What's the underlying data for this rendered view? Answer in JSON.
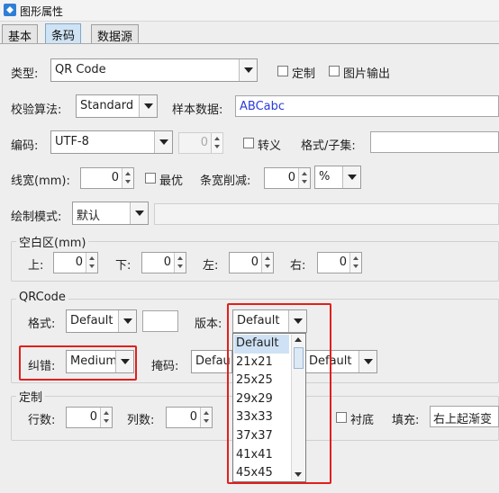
{
  "window": {
    "title": "图形属性"
  },
  "tabs": [
    "基本",
    "条码",
    "数据源"
  ],
  "colors": {
    "accent_tab": "#cfe3f5",
    "highlight_red": "#e0201c",
    "sample_text": "#2a3bd8"
  },
  "type_row": {
    "label": "类型:",
    "value": "QR Code",
    "custom_label": "定制",
    "image_output_label": "图片输出"
  },
  "checksum_row": {
    "label": "校验算法:",
    "value": "Standard",
    "sample_label": "样本数据:",
    "sample_value": "ABCabc"
  },
  "encoding_row": {
    "label": "编码:",
    "value": "UTF-8",
    "spin_value": "0",
    "escape_label": "转义",
    "format_label": "格式/子集:"
  },
  "linewidth_row": {
    "label": "线宽(mm):",
    "value": "0",
    "optimal_label": "最优",
    "bar_reduce_label": "条宽削减:",
    "bar_reduce_value": "0",
    "unit_value": "%"
  },
  "draw_mode_row": {
    "label": "绘制模式:",
    "value": "默认"
  },
  "quiet_zone": {
    "title": "空白区(mm)",
    "top_label": "上:",
    "top_value": "0",
    "bottom_label": "下:",
    "bottom_value": "0",
    "left_label": "左:",
    "left_value": "0",
    "right_label": "右:",
    "right_value": "0"
  },
  "qrcode": {
    "title": "QRCode",
    "format_label": "格式:",
    "format_value": "Default",
    "version_label": "版本:",
    "version_value": "Default",
    "ecc_label": "纠错:",
    "ecc_value": "Medium",
    "mask_label": "掩码:",
    "mask_value": "Default",
    "mode_value": "Default"
  },
  "custom_group": {
    "title": "定制",
    "rows_label": "行数:",
    "rows_value": "0",
    "cols_label": "列数:",
    "cols_value": "0",
    "bg_label": "衬底",
    "fill_label": "填充:",
    "fill_value": "右上起渐变"
  },
  "version_dropdown": {
    "items": [
      "Default",
      "21x21",
      "25x25",
      "29x29",
      "33x33",
      "37x37",
      "41x41",
      "45x45"
    ],
    "selected_index": 0
  }
}
